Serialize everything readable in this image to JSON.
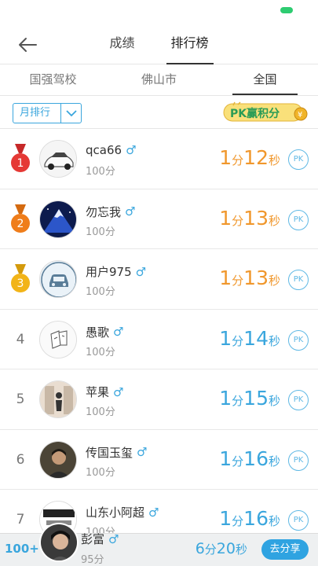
{
  "nav": {
    "tabs": [
      {
        "label": "成绩",
        "active": false
      },
      {
        "label": "排行榜",
        "active": true
      }
    ]
  },
  "subtabs": [
    {
      "label": "国强驾校",
      "active": false
    },
    {
      "label": "佛山市",
      "active": false
    },
    {
      "label": "全国",
      "active": true
    }
  ],
  "filter": {
    "period": "月排行",
    "pk_banner_text": "PK赢积分"
  },
  "colors": {
    "accent": "#3aa6dd",
    "gold_time": "#f0972c",
    "medal_1": "#e53935",
    "medal_2": "#ef7d1a",
    "medal_3": "#f2b418",
    "share_button": "#2fa3e1"
  },
  "ranking": [
    {
      "rank": "1",
      "medal": true,
      "name": "qca66",
      "gender_icon": "male-icon",
      "score": "100分",
      "min": "1",
      "min_unit": "分",
      "sec": "12",
      "sec_unit": "秒",
      "pk": "PK",
      "avatar": "car-avatar"
    },
    {
      "rank": "2",
      "medal": true,
      "name": "勿忘我",
      "gender_icon": "male-icon",
      "score": "100分",
      "min": "1",
      "min_unit": "分",
      "sec": "13",
      "sec_unit": "秒",
      "pk": "PK",
      "avatar": "mountain-avatar"
    },
    {
      "rank": "3",
      "medal": true,
      "name": "用户975",
      "gender_icon": "male-icon",
      "score": "100分",
      "min": "1",
      "min_unit": "分",
      "sec": "13",
      "sec_unit": "秒",
      "pk": "PK",
      "avatar": "default-car-avatar"
    },
    {
      "rank": "4",
      "medal": false,
      "name": "愚歌",
      "gender_icon": "male-icon",
      "score": "100分",
      "min": "1",
      "min_unit": "分",
      "sec": "14",
      "sec_unit": "秒",
      "pk": "PK",
      "avatar": "sketch-avatar"
    },
    {
      "rank": "5",
      "medal": false,
      "name": "苹果",
      "gender_icon": "male-icon",
      "score": "100分",
      "min": "1",
      "min_unit": "分",
      "sec": "15",
      "sec_unit": "秒",
      "pk": "PK",
      "avatar": "room-avatar"
    },
    {
      "rank": "6",
      "medal": false,
      "name": "传国玉玺",
      "gender_icon": "male-icon",
      "score": "100分",
      "min": "1",
      "min_unit": "分",
      "sec": "16",
      "sec_unit": "秒",
      "pk": "PK",
      "avatar": "portrait-avatar"
    },
    {
      "rank": "7",
      "medal": false,
      "name": "山东小阿超",
      "gender_icon": "male-icon",
      "score": "100分",
      "min": "1",
      "min_unit": "分",
      "sec": "16",
      "sec_unit": "秒",
      "pk": "PK",
      "avatar": "logo-avatar"
    }
  ],
  "me": {
    "rank": "100+",
    "name": "彭富",
    "gender_icon": "male-icon",
    "score": "95分",
    "min": "6",
    "min_unit": "分",
    "sec": "20",
    "sec_unit": "秒",
    "share_label": "去分享"
  }
}
